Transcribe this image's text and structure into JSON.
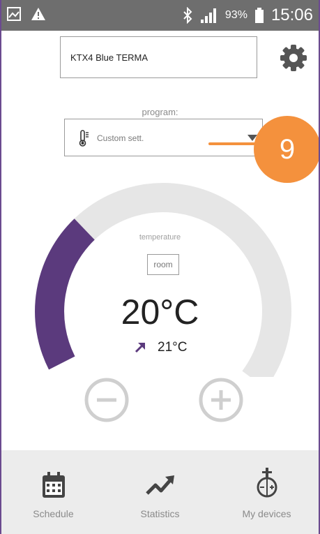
{
  "status_bar": {
    "battery_percent": "93%",
    "time": "15:06"
  },
  "header": {
    "device_name": "KTX4 Blue TERMA"
  },
  "program": {
    "label": "program:",
    "selected": "Custom sett."
  },
  "callout": {
    "number": "9",
    "color": "#f4913d"
  },
  "temperature": {
    "label": "temperature",
    "mode": "room",
    "setpoint": "20°C",
    "current": "21°C",
    "gauge_fill_fraction": 0.3
  },
  "colors": {
    "accent": "#5b3a7d",
    "status_bar": "#6e6e6e",
    "gauge_track": "#e6e6e6"
  },
  "nav": {
    "items": [
      {
        "label": "Schedule",
        "icon": "calendar-icon"
      },
      {
        "label": "Statistics",
        "icon": "trend-up-icon"
      },
      {
        "label": "My devices",
        "icon": "thermostat-device-icon"
      }
    ]
  }
}
